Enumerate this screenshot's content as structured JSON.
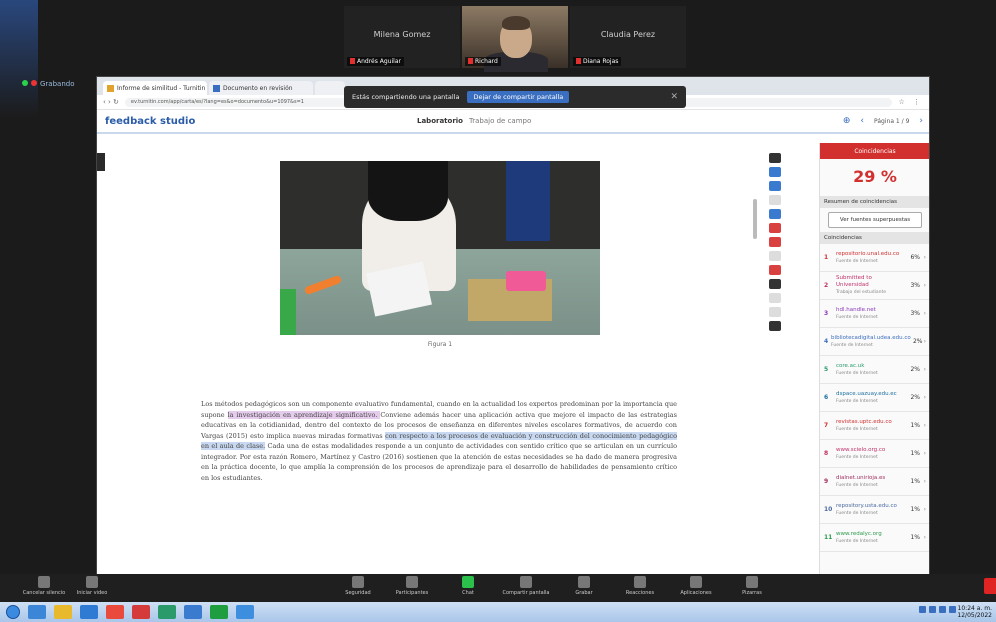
{
  "meeting": {
    "participants": [
      {
        "name": "Milena Gomez",
        "label": "Andrés Aguilar"
      },
      {
        "name": "Claudia Perez",
        "label": "Diana Rojas"
      }
    ],
    "camera_label": "Richard",
    "status_left": "Grabando"
  },
  "share_toast": {
    "text": "Estás compartiendo una pantalla",
    "share_button": "Dejar de compartir pantalla",
    "close": "✕"
  },
  "browser": {
    "tabs": [
      {
        "title": "Informe de similitud - Turnitin"
      },
      {
        "title": "Documento en revisión"
      },
      {
        "title": ""
      }
    ],
    "nav": "‹  ›  ↻",
    "url": "ev.turnitin.com/app/carta/es/?lang=es&o=documento&u=1097&s=1",
    "extensions": "☆ ⋮",
    "app_logo": "feedback studio",
    "doc_title": "Laboratorio",
    "doc_subtitle": "Trabajo de campo",
    "page_info": "Página 1 / 9",
    "header_icons": [
      "⊕",
      "‹",
      "›"
    ]
  },
  "document": {
    "caption": "Figura 1",
    "paragraph_pre": "Los métodos pedagógicos son un componente evaluativo fundamental, cuando en la actualidad los expertos predominan por la importancia que supone ",
    "hl1": "la investigación en aprendizaje significativo. ",
    "paragraph_mid": "Conviene además hacer una aplicación activa que mejore el impacto de las estrategias educativas en la cotidianidad, dentro del contexto de los procesos de enseñanza en diferentes niveles escolares formativos, de acuerdo con Vargas (2015) esto implica nuevas miradas formativas ",
    "hl2": "con respecto a los procesos de evaluación y construcción del conocimiento pedagógico en el aula de clase.",
    "paragraph_post": " Cada una de estas modalidades responde a un conjunto de actividades con sentido crítico que se articulan en un currículo integrador. Por esta razón Romero, Martínez y Castro (2016) sostienen que la atención de estas necesidades se ha dado de manera progresiva en la práctica docente, lo que amplía la comprensión de los procesos de aprendizaje para el desarrollo de habilidades de pensamiento crítico en los estudiantes."
  },
  "similarity": {
    "panel_title": "Coincidencias",
    "overall": "29 %",
    "section_overview": "Resumen de coincidencias",
    "view_button": "Ver fuentes superpuestas",
    "section_matches": "Coincidencias",
    "matches": [
      {
        "num": "1",
        "source": "repositorio.unal.edu.co",
        "type": "Fuente de Internet",
        "pct": "6%",
        "color": "#d22f2f"
      },
      {
        "num": "2",
        "source": "Submitted to Universidad",
        "type": "Trabajo del estudiante",
        "pct": "3%",
        "color": "#c0306a"
      },
      {
        "num": "3",
        "source": "hdl.handle.net",
        "type": "Fuente de Internet",
        "pct": "3%",
        "color": "#8a3ab9"
      },
      {
        "num": "4",
        "source": "bibliotecadigital.udea.edu.co",
        "type": "Fuente de Internet",
        "pct": "2%",
        "color": "#3a6ec0"
      },
      {
        "num": "5",
        "source": "core.ac.uk",
        "type": "Fuente de Internet",
        "pct": "2%",
        "color": "#2a9a6a"
      },
      {
        "num": "6",
        "source": "dspace.uazuay.edu.ec",
        "type": "Fuente de Internet",
        "pct": "2%",
        "color": "#1c6fa0"
      },
      {
        "num": "7",
        "source": "revistas.uptc.edu.co",
        "type": "Fuente de Internet",
        "pct": "1%",
        "color": "#d22f2f"
      },
      {
        "num": "8",
        "source": "www.scielo.org.co",
        "type": "Fuente de Internet",
        "pct": "1%",
        "color": "#c0306a"
      },
      {
        "num": "9",
        "source": "dialnet.unirioja.es",
        "type": "Fuente de Internet",
        "pct": "1%",
        "color": "#a03060"
      },
      {
        "num": "10",
        "source": "repository.usta.edu.co",
        "type": "Fuente de Internet",
        "pct": "1%",
        "color": "#4a6aa0"
      },
      {
        "num": "11",
        "source": "www.redalyc.org",
        "type": "Fuente de Internet",
        "pct": "1%",
        "color": "#2a9a4a"
      }
    ]
  },
  "zoom_controls": [
    {
      "label": "Cancelar silencio"
    },
    {
      "label": "Iniciar video"
    },
    {
      "label": "Seguridad"
    },
    {
      "label": "Participantes"
    },
    {
      "label": "Chat"
    },
    {
      "label": "Compartir pantalla"
    },
    {
      "label": "Grabar"
    },
    {
      "label": "Reacciones"
    },
    {
      "label": "Aplicaciones"
    },
    {
      "label": "Pizarras"
    }
  ],
  "taskbar": {
    "clock_time": "10:24 a. m.",
    "clock_date": "12/05/2022",
    "icon_colors": [
      "#3b86d6",
      "#e8b92c",
      "#2f7bd4",
      "#e94a3c",
      "#d63b3b",
      "#2a9a6a",
      "#3a7bd0",
      "#1f9e3f",
      "#3e8ee0"
    ]
  }
}
